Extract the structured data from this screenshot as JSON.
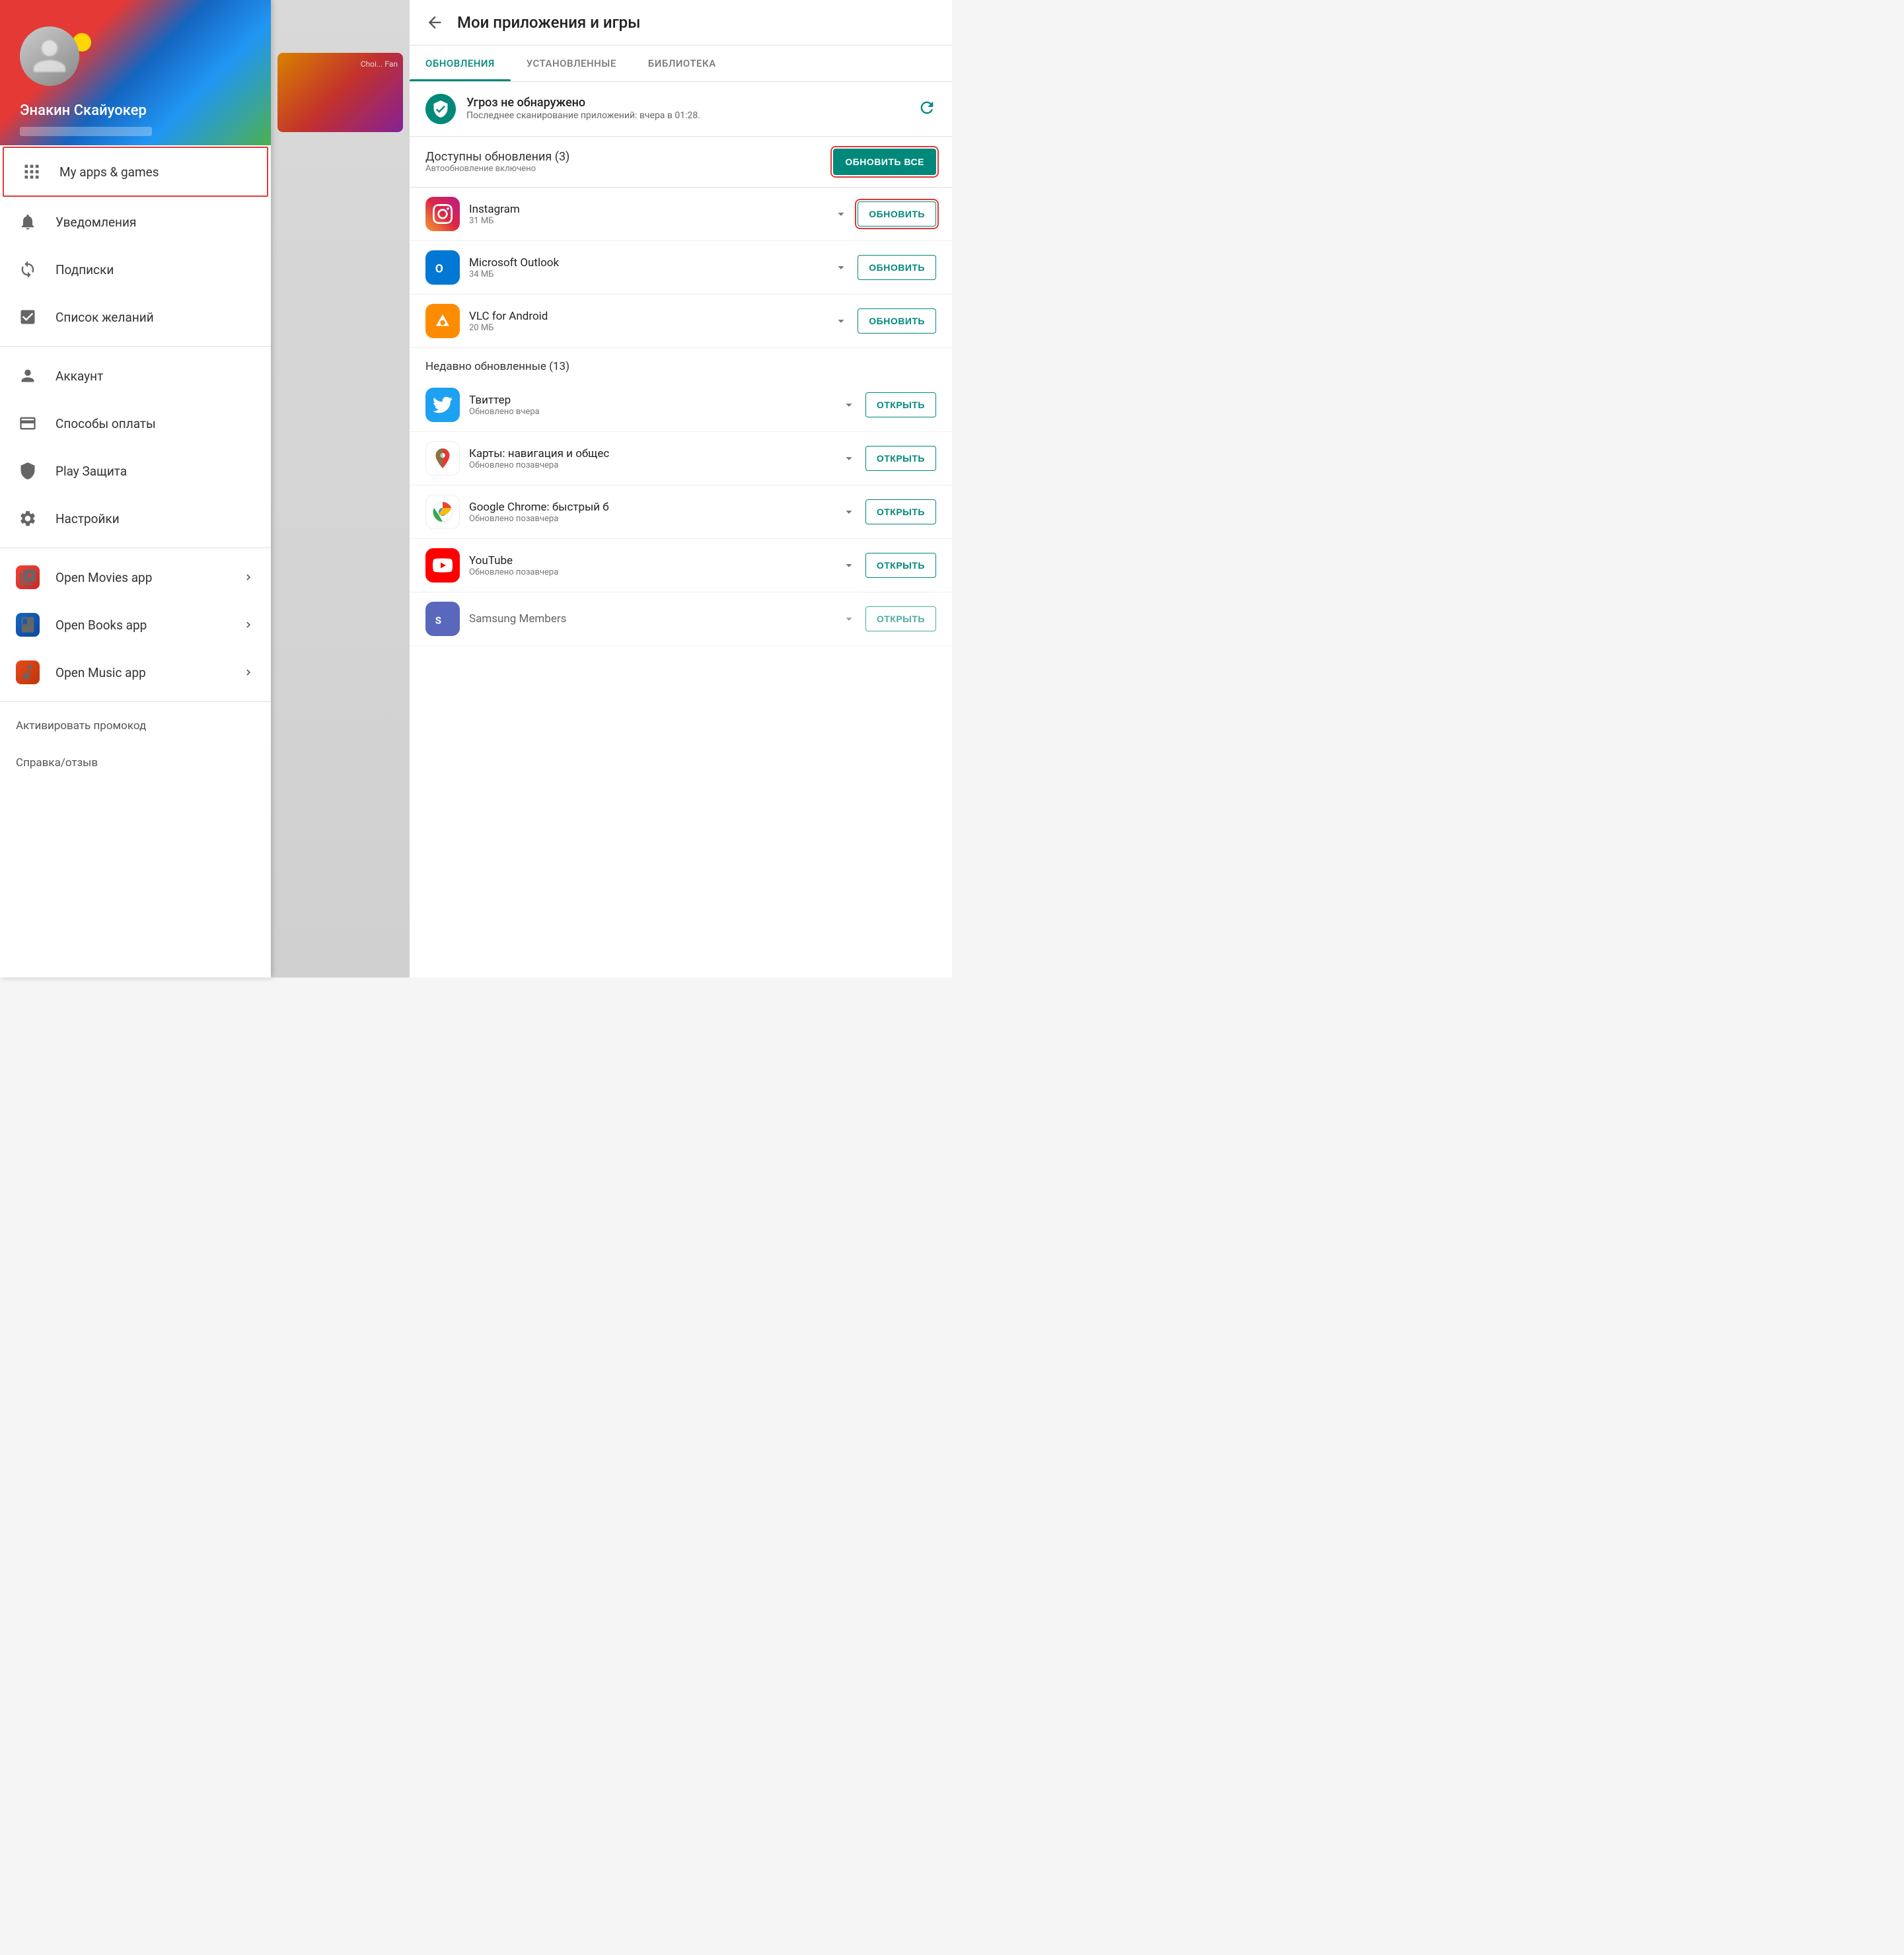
{
  "drawer": {
    "user": {
      "name": "Энакин Скайуокер"
    },
    "menu_item_my_apps": "My apps & games",
    "menu_item_notifications": "Уведомления",
    "menu_item_subscriptions": "Подписки",
    "menu_item_wishlist": "Список желаний",
    "menu_item_account": "Аккаунт",
    "menu_item_payment": "Способы оплаты",
    "menu_item_play_protect": "Play Защита",
    "menu_item_settings": "Настройки",
    "menu_item_movies": "Open Movies app",
    "menu_item_books": "Open Books app",
    "menu_item_music": "Open Music app",
    "footer_promo": "Активировать промокод",
    "footer_help": "Справка/отзыв"
  },
  "right_panel": {
    "back_label": "←",
    "title": "Мои приложения и игры",
    "tabs": {
      "updates": "ОБНОВЛЕНИЯ",
      "installed": "УСТАНОВЛЕННЫЕ",
      "library": "БИБЛИОТЕКА"
    },
    "security": {
      "title": "Угроз не обнаружено",
      "subtitle": "Последнее сканирование приложений: вчера в 01:28."
    },
    "updates_section": {
      "title": "Доступны обновления (3)",
      "subtitle": "Автообновление включено",
      "update_all_label": "ОБНОВИТЬ ВСЕ"
    },
    "apps": [
      {
        "name": "Instagram",
        "size": "31 МБ",
        "action": "ОБНОВИТЬ",
        "highlighted": true
      },
      {
        "name": "Microsoft Outlook",
        "size": "34 МБ",
        "action": "ОБНОВИТЬ",
        "highlighted": false
      },
      {
        "name": "VLC for Android",
        "size": "20 МБ",
        "action": "ОБНОВИТЬ",
        "highlighted": false
      }
    ],
    "recently_updated_label": "Недавно обновленные (13)",
    "recent_apps": [
      {
        "name": "Твиттер",
        "updated": "Обновлено вчера",
        "action": "ОТКРЫТЬ"
      },
      {
        "name": "Карты: навигация и общес",
        "updated": "Обновлено позавчера",
        "action": "ОТКРЫТЬ"
      },
      {
        "name": "Google Chrome: быстрый б",
        "updated": "Обновлено позавчера",
        "action": "ОТКРЫТЬ"
      },
      {
        "name": "YouTube",
        "updated": "Обновлено позавчера",
        "action": "ОТКРЫТЬ"
      },
      {
        "name": "Samsung Members",
        "updated": "",
        "action": "ОТКРЫТЬ"
      }
    ]
  }
}
